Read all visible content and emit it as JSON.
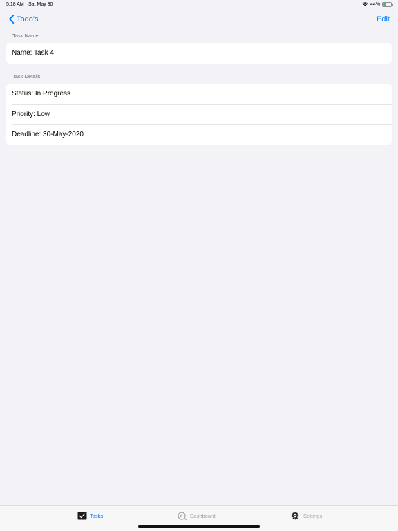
{
  "status_bar": {
    "time": "5:18 AM",
    "date": "Sat May 30",
    "battery": "44%",
    "battery_level": 0.44
  },
  "nav": {
    "back_label": "Todo's",
    "edit_label": "Edit"
  },
  "sections": {
    "task_name": {
      "header": "Task Name",
      "name_row": "Name: Task 4"
    },
    "task_details": {
      "header": "Task Details",
      "status_row": "Status: In Progress",
      "priority_row": "Priority: Low",
      "deadline_row": "Deadline: 30-May-2020"
    }
  },
  "tabs": {
    "tasks": {
      "label": "Tasks",
      "icon": "tasks-icon"
    },
    "dashboard": {
      "label": "Dashboard",
      "icon": "dashboard-icon"
    },
    "settings": {
      "label": "Settings",
      "icon": "gear-icon"
    }
  },
  "colors": {
    "accent": "#007aff",
    "background": "#f2f2f7",
    "battery": "#34c759"
  }
}
